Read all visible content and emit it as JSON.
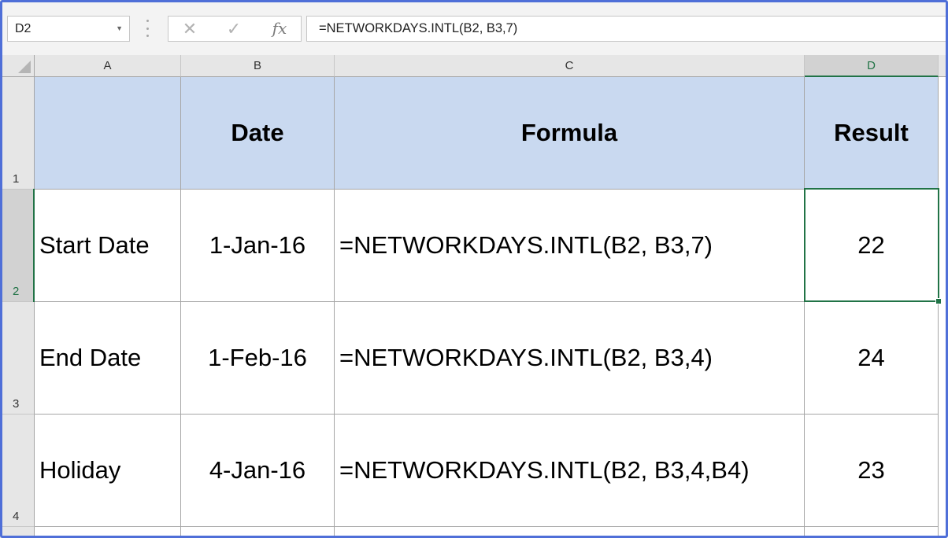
{
  "formula_bar": {
    "name_box": "D2",
    "cancel_icon": "✕",
    "enter_icon": "✓",
    "fx_label": "fx",
    "formula": "=NETWORKDAYS.INTL(B2, B3,7)"
  },
  "columns": [
    "A",
    "B",
    "C",
    "D"
  ],
  "rows": [
    "1",
    "2",
    "3",
    "4"
  ],
  "selected_cell": "D2",
  "sheet": {
    "header": [
      "",
      "Date",
      "Formula",
      "Result"
    ],
    "data": [
      {
        "label": "Start Date",
        "date": "1-Jan-16",
        "formula": "=NETWORKDAYS.INTL(B2, B3,7)",
        "result": "22"
      },
      {
        "label": "End Date",
        "date": "1-Feb-16",
        "formula": "=NETWORKDAYS.INTL(B2, B3,4)",
        "result": "24"
      },
      {
        "label": "Holiday",
        "date": "4-Jan-16",
        "formula": "=NETWORKDAYS.INTL(B2, B3,4,B4)",
        "result": "23"
      }
    ]
  },
  "colors": {
    "header_fill": "#c9d9f0",
    "selection": "#217346",
    "frame": "#4f6fd8"
  }
}
